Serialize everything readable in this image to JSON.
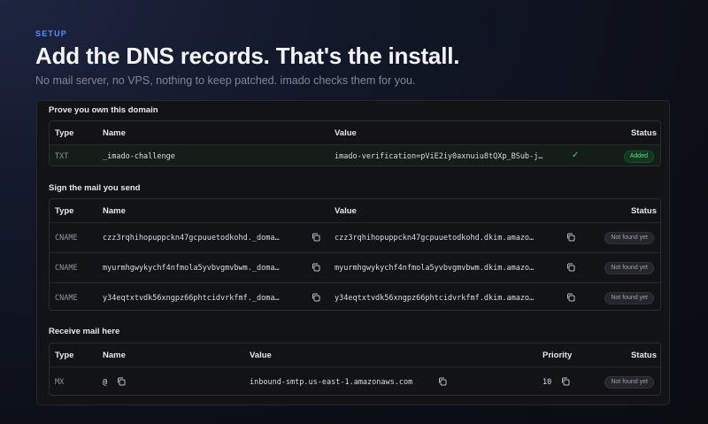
{
  "header": {
    "eyebrow": "SETUP",
    "title": "Add the DNS records. That's the install.",
    "subtitle": "No mail server, no VPS, nothing to keep patched. imado checks them for you."
  },
  "colors": {
    "accent": "#5b8dff",
    "added_green": "#5fd88a",
    "background": "#0c0f18"
  },
  "sections": {
    "verify": {
      "label": "Prove you own this domain",
      "headers": {
        "type": "Type",
        "name": "Name",
        "value": "Value",
        "status": "Status"
      },
      "rows": [
        {
          "type": "TXT",
          "name": "_imado-challenge",
          "value": "imado-verification=pViE2iy0axnuiu8tQXp_BSub-j…",
          "status": "Added"
        }
      ]
    },
    "dkim": {
      "label": "Sign the mail you send",
      "headers": {
        "type": "Type",
        "name": "Name",
        "value": "Value",
        "status": "Status"
      },
      "rows": [
        {
          "type": "CNAME",
          "name": "czz3rqhihopuppckn47gcpuuetodkohd._doma…",
          "value": "czz3rqhihopuppckn47gcpuuetodkohd.dkim.amazo…",
          "status": "Not found yet"
        },
        {
          "type": "CNAME",
          "name": "myurmhgwykychf4nfmola5yvbvgmvbwm._doma…",
          "value": "myurmhgwykychf4nfmola5yvbvgmvbwm.dkim.amazo…",
          "status": "Not found yet"
        },
        {
          "type": "CNAME",
          "name": "y34eqtxtvdk56xngpz66phtcidvrkfmf._doma…",
          "value": "y34eqtxtvdk56xngpz66phtcidvrkfmf.dkim.amazo…",
          "status": "Not found yet"
        }
      ]
    },
    "mx": {
      "label": "Receive mail here",
      "headers": {
        "type": "Type",
        "name": "Name",
        "value": "Value",
        "priority": "Priority",
        "status": "Status"
      },
      "rows": [
        {
          "type": "MX",
          "name": "@",
          "value": "inbound-smtp.us-east-1.amazonaws.com",
          "priority": "10",
          "status": "Not found yet"
        }
      ]
    }
  },
  "icons": {
    "copy": "copy-icon",
    "check": "check-icon"
  }
}
